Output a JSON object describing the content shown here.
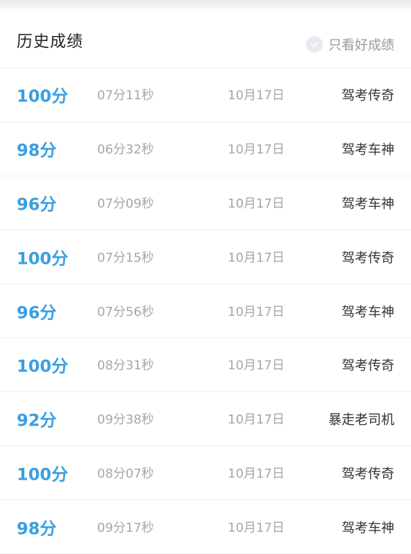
{
  "header": {
    "title": "历史成绩",
    "filter_label": "只看好成绩",
    "filter_checked": false
  },
  "records": [
    {
      "score": "100分",
      "time": "07分11秒",
      "date": "10月17日",
      "badge": "驾考传奇"
    },
    {
      "score": "98分",
      "time": "06分32秒",
      "date": "10月17日",
      "badge": "驾考车神"
    },
    {
      "score": "96分",
      "time": "07分09秒",
      "date": "10月17日",
      "badge": "驾考车神"
    },
    {
      "score": "100分",
      "time": "07分15秒",
      "date": "10月17日",
      "badge": "驾考传奇"
    },
    {
      "score": "96分",
      "time": "07分56秒",
      "date": "10月17日",
      "badge": "驾考车神"
    },
    {
      "score": "100分",
      "time": "08分31秒",
      "date": "10月17日",
      "badge": "驾考传奇"
    },
    {
      "score": "92分",
      "time": "09分38秒",
      "date": "10月17日",
      "badge": "暴走老司机"
    },
    {
      "score": "100分",
      "time": "08分07秒",
      "date": "10月17日",
      "badge": "驾考传奇"
    },
    {
      "score": "98分",
      "time": "09分17秒",
      "date": "10月17日",
      "badge": "驾考车神"
    }
  ],
  "colors": {
    "score": "#3a9fe0",
    "secondary_text": "#a6a6ab",
    "primary_text": "#222222"
  }
}
